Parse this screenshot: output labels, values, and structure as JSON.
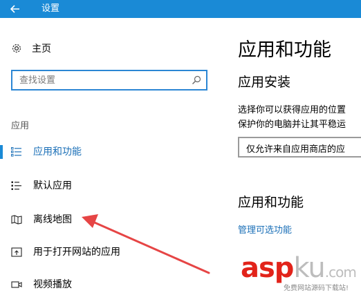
{
  "window": {
    "title": "设置"
  },
  "sidebar": {
    "home_label": "主页",
    "search_placeholder": "查找设置",
    "section_label": "应用",
    "items": [
      {
        "label": "应用和功能",
        "icon": "apps-features-icon",
        "selected": true
      },
      {
        "label": "默认应用",
        "icon": "default-apps-icon",
        "selected": false
      },
      {
        "label": "离线地图",
        "icon": "offline-maps-icon",
        "selected": false
      },
      {
        "label": "用于打开网站的应用",
        "icon": "apps-for-websites-icon",
        "selected": false
      },
      {
        "label": "视频播放",
        "icon": "video-playback-icon",
        "selected": false
      }
    ]
  },
  "main": {
    "title": "应用和功能",
    "install_heading": "应用安装",
    "install_desc_line1": "选择你可以获得应用的位置",
    "install_desc_line2": "保护你的电脑并让其平稳运",
    "install_dropdown_value": "仅允许来自应用商店的应",
    "features_heading": "应用和功能",
    "manage_link": "管理可选功能"
  },
  "watermark": {
    "brand_red": "asp",
    "brand_gray": "ku",
    "brand_suffix": ".com",
    "subtitle": "免费网站源码下载站!"
  },
  "colors": {
    "titlebar": "#1a8ad6",
    "accent": "#1a8ad6",
    "link": "#1a6fb7",
    "annotation_arrow": "#e64545",
    "watermark_red": "#e2231a"
  }
}
